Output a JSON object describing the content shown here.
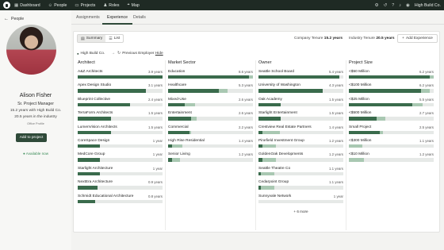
{
  "nav": {
    "items": [
      {
        "label": "Dashboard",
        "icon": "grid-icon"
      },
      {
        "label": "People",
        "icon": "people-icon"
      },
      {
        "label": "Projects",
        "icon": "folder-icon"
      },
      {
        "label": "Roles",
        "icon": "roles-icon"
      },
      {
        "label": "Map",
        "icon": "map-icon"
      }
    ],
    "company": "High Build Co."
  },
  "profile": {
    "back_label": "People",
    "name": "Alison Fisher",
    "title": "Sr. Project Manager",
    "tenure_company": "15.2 years with High Build Co.",
    "tenure_industry": "20.5 years in the industry",
    "office": "Office Profile",
    "add_button": "Add to project",
    "availability": "Available now"
  },
  "tabs": [
    {
      "label": "Assignments"
    },
    {
      "label": "Experience",
      "active": true
    },
    {
      "label": "Details"
    }
  ],
  "toolbar": {
    "summary_label": "Summary",
    "list_label": "List",
    "company_tenure_label": "Company Tenure",
    "company_tenure_value": "15.2 years",
    "industry_tenure_label": "Industry Tenure",
    "industry_tenure_value": "20.5 years",
    "add_experience_label": "Add Experience"
  },
  "legend": {
    "current": "High Build Co.",
    "previous": "Previous Employer",
    "hide": "Hide"
  },
  "colors": {
    "accent": "#2f4a39",
    "bar_dark": "#3a6b4c",
    "bar_light": "#a9c8b2",
    "track": "#e6e9e7"
  },
  "columns": [
    {
      "heading": "Architect",
      "rows": [
        {
          "label": "A&Z Architects",
          "value": "3.9 years",
          "primary": 1.0,
          "secondary": 0
        },
        {
          "label": "Apex Design Studio",
          "value": "3.1 years",
          "primary": 0.8,
          "secondary": 0
        },
        {
          "label": "Blueprint Collective",
          "value": "2.4 years",
          "primary": 0.62,
          "secondary": 0
        },
        {
          "label": "TerraForm Architects",
          "value": "1.5 years",
          "primary": 0.39,
          "secondary": 0
        },
        {
          "label": "LumenVision Architects",
          "value": "1.5 years",
          "primary": 0.39,
          "secondary": 0
        },
        {
          "label": "CoreSpace Design",
          "value": "1 year",
          "primary": 0.26,
          "secondary": 0
        },
        {
          "label": "MedCore Group",
          "value": "1 year",
          "primary": 0.26,
          "secondary": 0
        },
        {
          "label": "Starlight Architecture",
          "value": "1 year",
          "primary": 0.26,
          "secondary": 0
        },
        {
          "label": "NextEra Architecture",
          "value": "0.9 years",
          "primary": 0.23,
          "secondary": 0
        },
        {
          "label": "Schmidt Educational Architecture",
          "value": "0.8 years",
          "primary": 0.21,
          "secondary": 0
        }
      ]
    },
    {
      "heading": "Market Sector",
      "rows": [
        {
          "label": "Education",
          "value": "8.6 years",
          "primary": 0.95,
          "secondary": 0.05
        },
        {
          "label": "Healthcare",
          "value": "5.3 years",
          "primary": 0.6,
          "secondary": 0.1
        },
        {
          "label": "Mixed-Use",
          "value": "2.6 years",
          "primary": 0.2,
          "secondary": 0.12
        },
        {
          "label": "Entertainment",
          "value": "2.6 years",
          "primary": 0.27,
          "secondary": 0.07
        },
        {
          "label": "Commercial",
          "value": "2.2 years",
          "primary": 0.25,
          "secondary": 0.02
        },
        {
          "label": "High Rise Residential",
          "value": "1.4 years",
          "primary": 0.05,
          "secondary": 0.12
        },
        {
          "label": "Senior Living",
          "value": "1.2 years",
          "primary": 0.05,
          "secondary": 0.09
        }
      ]
    },
    {
      "heading": "Owner",
      "rows": [
        {
          "label": "Seattle School Board",
          "value": "5.4 years",
          "primary": 0.95,
          "secondary": 0
        },
        {
          "label": "University of Washington",
          "value": "4.3 years",
          "primary": 0.76,
          "secondary": 0
        },
        {
          "label": "Oak Academy",
          "value": "1.5 years",
          "primary": 0.26,
          "secondary": 0
        },
        {
          "label": "Starlight Entertainment",
          "value": "1.5 years",
          "primary": 0.26,
          "secondary": 0
        },
        {
          "label": "Crestview Real Estate Partners",
          "value": "1.4 years",
          "primary": 0.05,
          "secondary": 0.2
        },
        {
          "label": "Pinefield Investment Group",
          "value": "1.2 years",
          "primary": 0.05,
          "secondary": 0.16
        },
        {
          "label": "GoldenOak Developments",
          "value": "1.2 years",
          "primary": 0.05,
          "secondary": 0.16
        },
        {
          "label": "Seattle Theatre Co",
          "value": "1.1 years",
          "primary": 0.03,
          "secondary": 0.16
        },
        {
          "label": "Cedarpoint Group",
          "value": "1.1 years",
          "primary": 0.03,
          "secondary": 0.16
        },
        {
          "label": "Sunnyvale Network",
          "value": "1 year",
          "primary": 0.0,
          "secondary": 0
        }
      ],
      "more_label": "+ 6 more"
    },
    {
      "heading": "Project Size",
      "rows": [
        {
          "label": "<$50 Million",
          "value": "6.2 years",
          "primary": 0.95,
          "secondary": 0.05
        },
        {
          "label": "<$100 Million",
          "value": "6.2 years",
          "primary": 0.85,
          "secondary": 0.1
        },
        {
          "label": "<$25 Million",
          "value": "5.5 years",
          "primary": 0.75,
          "secondary": 0.12
        },
        {
          "label": "<$500 Million",
          "value": "2.7 years",
          "primary": 0.33,
          "secondary": 0.1
        },
        {
          "label": "Small Project",
          "value": "2.5 years",
          "primary": 0.36,
          "secondary": 0.04
        },
        {
          "label": "<$300 Million",
          "value": "1.1 years",
          "primary": 0.0,
          "secondary": 0.16
        },
        {
          "label": "<$10 Million",
          "value": "1.2 years",
          "primary": 0.0,
          "secondary": 0.18
        }
      ]
    }
  ]
}
